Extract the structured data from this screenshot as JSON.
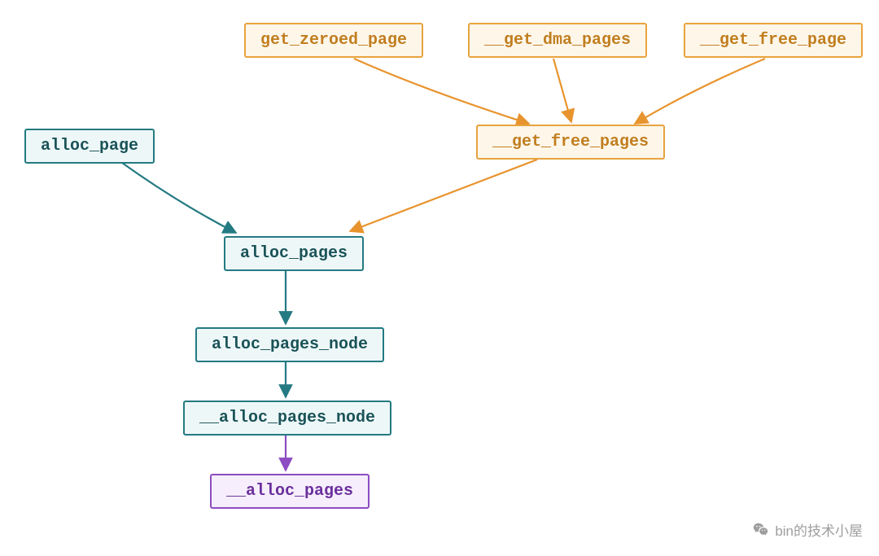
{
  "nodes": {
    "get_zeroed_page": "get_zeroed_page",
    "get_dma_pages": "__get_dma_pages",
    "get_free_page": "__get_free_page",
    "alloc_page": "alloc_page",
    "get_free_pages": "__get_free_pages",
    "alloc_pages": "alloc_pages",
    "alloc_pages_node": "alloc_pages_node",
    "__alloc_pages_node": "__alloc_pages_node",
    "__alloc_pages": "__alloc_pages"
  },
  "watermark": {
    "text": "bin的技术小屋"
  },
  "edges": [
    {
      "from": "get_zeroed_page",
      "to": "get_free_pages",
      "color": "orange"
    },
    {
      "from": "get_dma_pages",
      "to": "get_free_pages",
      "color": "orange"
    },
    {
      "from": "get_free_page",
      "to": "get_free_pages",
      "color": "orange"
    },
    {
      "from": "get_free_pages",
      "to": "alloc_pages",
      "color": "orange"
    },
    {
      "from": "alloc_page",
      "to": "alloc_pages",
      "color": "teal"
    },
    {
      "from": "alloc_pages",
      "to": "alloc_pages_node",
      "color": "teal"
    },
    {
      "from": "alloc_pages_node",
      "to": "__alloc_pages_node",
      "color": "teal"
    },
    {
      "from": "__alloc_pages_node",
      "to": "__alloc_pages",
      "color": "purple"
    }
  ]
}
